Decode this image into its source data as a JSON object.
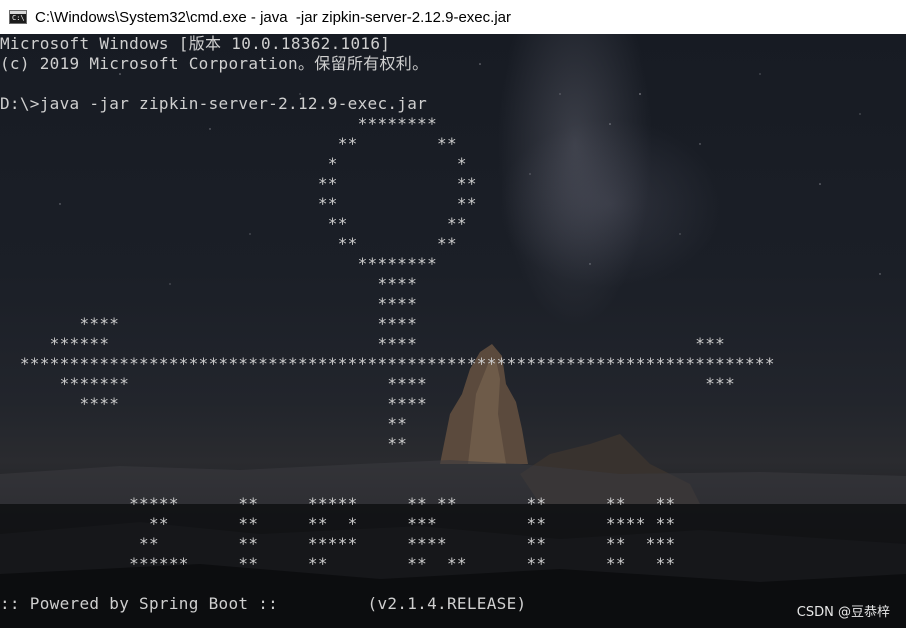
{
  "window": {
    "title": "C:\\Windows\\System32\\cmd.exe - java  -jar zipkin-server-2.12.9-exec.jar",
    "icon": "cmd-icon",
    "icon_text": "C:\\"
  },
  "console": {
    "lines": [
      "Microsoft Windows [版本 10.0.18362.1016]",
      "(c) 2019 Microsoft Corporation。保留所有权利。",
      "",
      "D:\\>java -jar zipkin-server-2.12.9-exec.jar",
      "                                    ********",
      "                                  **        **",
      "                                 *            *",
      "                                **            **",
      "                                **            **",
      "                                 **          **",
      "                                  **        **",
      "                                    ********",
      "                                      ****",
      "                                      ****",
      "        ****                          ****",
      "     ******                           ****                            ***",
      "  ****************************************************************************",
      "      *******                          ****                            ***",
      "        ****                           ****",
      "                                       **",
      "                                       **",
      "",
      "",
      "             *****      **     *****     ** **       **      **   **",
      "               **       **     **  *     ***         **      **** **",
      "              **        **     *****     ****        **      **  ***",
      "             ******     **     **        **  **      **      **   **",
      "",
      ":: Powered by Spring Boot ::         (v2.1.4.RELEASE)"
    ]
  },
  "watermark": "CSDN @豆恭梓"
}
